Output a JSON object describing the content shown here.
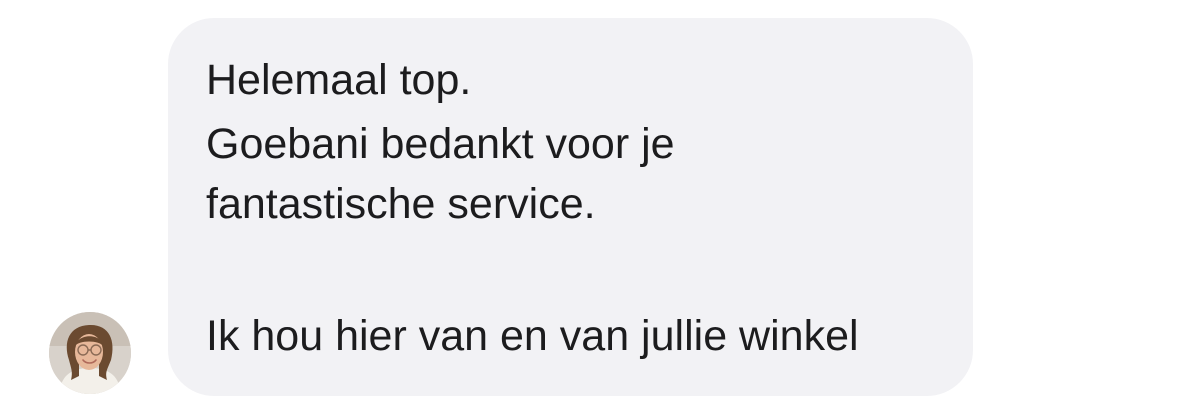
{
  "conversation": {
    "avatar_icon": "person-avatar-icon",
    "message": {
      "lines": [
        "Helemaal top.",
        "Goebani bedankt voor je",
        "fantastische service.",
        "Ik hou hier van en van jullie winkel"
      ],
      "bubble_color": "#f2f2f5",
      "text_color": "#1c1c1e"
    }
  }
}
